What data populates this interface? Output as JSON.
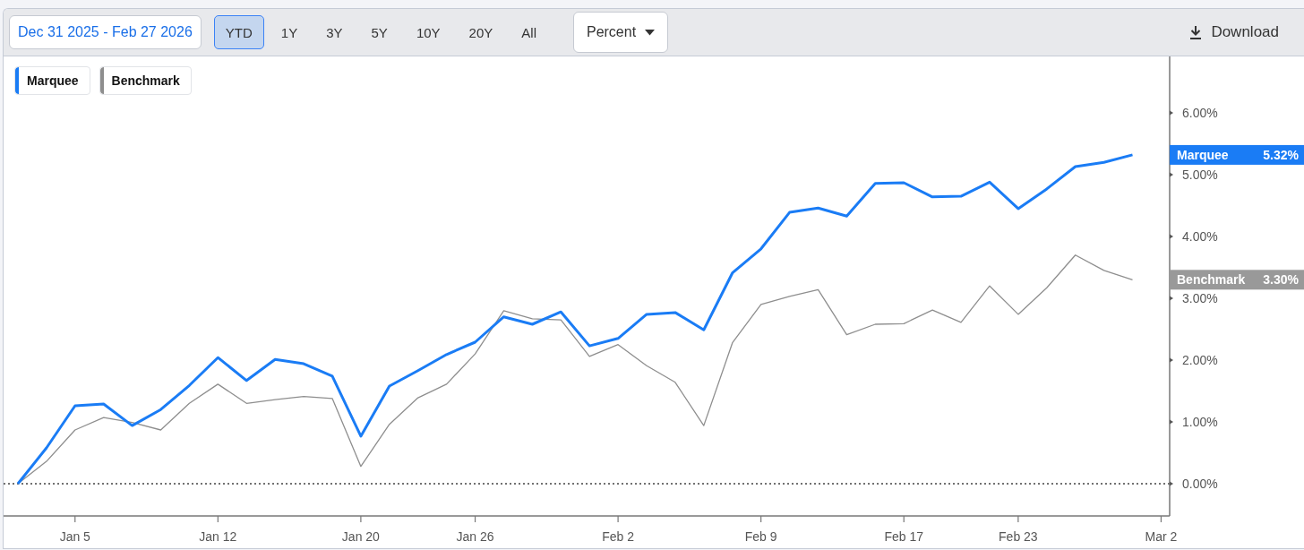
{
  "toolbar": {
    "date_range": "Dec 31 2025 - Feb 27 2026",
    "periods": [
      {
        "label": "YTD",
        "selected": true
      },
      {
        "label": "1Y",
        "selected": false
      },
      {
        "label": "3Y",
        "selected": false
      },
      {
        "label": "5Y",
        "selected": false
      },
      {
        "label": "10Y",
        "selected": false
      },
      {
        "label": "20Y",
        "selected": false
      },
      {
        "label": "All",
        "selected": false
      }
    ],
    "unit_select": {
      "value": "Percent"
    },
    "download": {
      "label": "Download"
    }
  },
  "chart": {
    "value_tags": [
      {
        "name": "Marquee",
        "value": "5.32%",
        "color": "#1a7cf5"
      },
      {
        "name": "Benchmark",
        "value": "3.30%",
        "color": "#999999"
      }
    ],
    "chart_data": {
      "type": "line",
      "categories": [
        null,
        null,
        "Jan 5",
        null,
        null,
        null,
        null,
        "Jan 12",
        null,
        null,
        null,
        null,
        "Jan 20",
        null,
        null,
        null,
        "Jan 26",
        null,
        null,
        null,
        null,
        "Feb 2",
        null,
        null,
        null,
        null,
        "Feb 9",
        null,
        null,
        null,
        null,
        "Feb 17",
        null,
        null,
        null,
        "Feb 23",
        null,
        null,
        null,
        null,
        "Mar 2"
      ],
      "series": [
        {
          "name": "Marquee",
          "color": "#1a7cf5",
          "values": [
            0,
            0.58,
            1.26,
            1.29,
            0.94,
            1.2,
            1.59,
            2.04,
            1.67,
            2.01,
            1.94,
            1.74,
            0.77,
            1.58,
            1.83,
            2.09,
            2.29,
            2.7,
            2.58,
            2.78,
            2.23,
            2.35,
            2.74,
            2.77,
            2.49,
            3.41,
            3.8,
            4.39,
            4.46,
            4.33,
            4.86,
            4.87,
            4.64,
            4.65,
            4.88,
            4.45,
            4.77,
            5.13,
            5.2,
            5.32,
            null
          ]
        },
        {
          "name": "Benchmark",
          "color": "#8e8e8e",
          "values": [
            0,
            0.36,
            0.87,
            1.07,
            0.99,
            0.87,
            1.3,
            1.61,
            1.3,
            1.36,
            1.41,
            1.38,
            0.28,
            0.96,
            1.39,
            1.61,
            2.1,
            2.8,
            2.67,
            2.65,
            2.06,
            2.25,
            1.91,
            1.64,
            0.94,
            2.28,
            2.9,
            3.03,
            3.14,
            2.41,
            2.58,
            2.59,
            2.81,
            2.61,
            3.2,
            2.74,
            3.17,
            3.7,
            3.45,
            3.3,
            null
          ]
        }
      ],
      "ylim": [
        -0.522,
        6.913
      ],
      "yticks": [
        {
          "value": 0,
          "label": "0.00%"
        },
        {
          "value": 1,
          "label": "1.00%"
        },
        {
          "value": 2,
          "label": "2.00%"
        },
        {
          "value": 3,
          "label": "3.00%"
        },
        {
          "value": 4,
          "label": "4.00%"
        },
        {
          "value": 5,
          "label": "5.00%"
        },
        {
          "value": 6,
          "label": "6.00%"
        }
      ]
    }
  }
}
